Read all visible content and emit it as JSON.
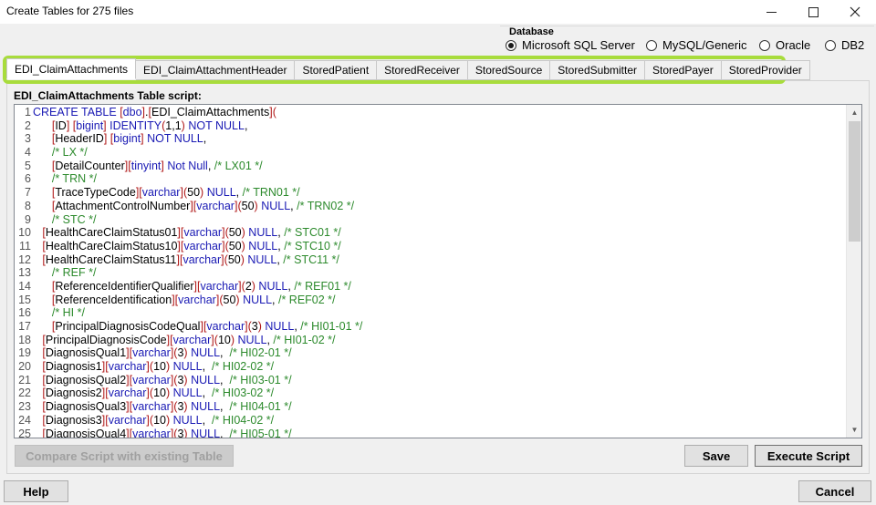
{
  "window": {
    "title": "Create Tables for 275 files"
  },
  "database": {
    "legend": "Database",
    "options": [
      {
        "label": "Microsoft SQL Server",
        "selected": true
      },
      {
        "label": "MySQL/Generic",
        "selected": false
      },
      {
        "label": "Oracle",
        "selected": false
      },
      {
        "label": "DB2",
        "selected": false
      }
    ]
  },
  "tabs": [
    {
      "label": "EDI_ClaimAttachments",
      "active": true
    },
    {
      "label": "EDI_ClaimAttachmentHeader",
      "active": false
    },
    {
      "label": "StoredPatient",
      "active": false
    },
    {
      "label": "StoredReceiver",
      "active": false
    },
    {
      "label": "StoredSource",
      "active": false
    },
    {
      "label": "StoredSubmitter",
      "active": false
    },
    {
      "label": "StoredPayer",
      "active": false
    },
    {
      "label": "StoredProvider",
      "active": false
    }
  ],
  "script": {
    "label": "EDI_ClaimAttachments Table script:",
    "lines": [
      "CREATE TABLE [dbo].[EDI_ClaimAttachments](",
      "      [ID] [bigint] IDENTITY(1,1) NOT NULL,",
      "      [HeaderID] [bigint] NOT NULL,",
      "      /* LX */",
      "      [DetailCounter][tinyint] Not Null, /* LX01 */",
      "      /* TRN */",
      "      [TraceTypeCode][varchar](50) NULL, /* TRN01 */",
      "      [AttachmentControlNumber][varchar](50) NULL, /* TRN02 */",
      "      /* STC */",
      "   [HealthCareClaimStatus01][varchar](50) NULL, /* STC01 */",
      "   [HealthCareClaimStatus10][varchar](50) NULL, /* STC10 */",
      "   [HealthCareClaimStatus11][varchar](50) NULL, /* STC11 */",
      "      /* REF */",
      "      [ReferenceIdentifierQualifier][varchar](2) NULL, /* REF01 */",
      "      [ReferenceIdentification][varchar](50) NULL, /* REF02 */",
      "      /* HI */",
      "      [PrincipalDiagnosisCodeQual][varchar](3) NULL, /* HI01-01 */",
      "   [PrincipalDiagnosisCode][varchar](10) NULL, /* HI01-02 */",
      "   [DiagnosisQual1][varchar](3) NULL,  /* HI02-01 */",
      "   [Diagnosis1][varchar](10) NULL,  /* HI02-02 */",
      "   [DiagnosisQual2][varchar](3) NULL,  /* HI03-01 */",
      "   [Diagnosis2][varchar](10) NULL,  /* HI03-02 */",
      "   [DiagnosisQual3][varchar](3) NULL,  /* HI04-01 */",
      "   [Diagnosis3][varchar](10) NULL,  /* HI04-02 */",
      "   [DiagnosisQual4][varchar](3) NULL,  /* HI05-01 */"
    ]
  },
  "buttons": {
    "compare": "Compare Script with existing Table",
    "save": "Save",
    "execute": "Execute Script",
    "help": "Help",
    "cancel": "Cancel"
  },
  "colors": {
    "tab_highlight": "#a8dc3c",
    "keyword": "#1a1ab4",
    "comment": "#2c8a2c",
    "bracket": "#b01818"
  }
}
